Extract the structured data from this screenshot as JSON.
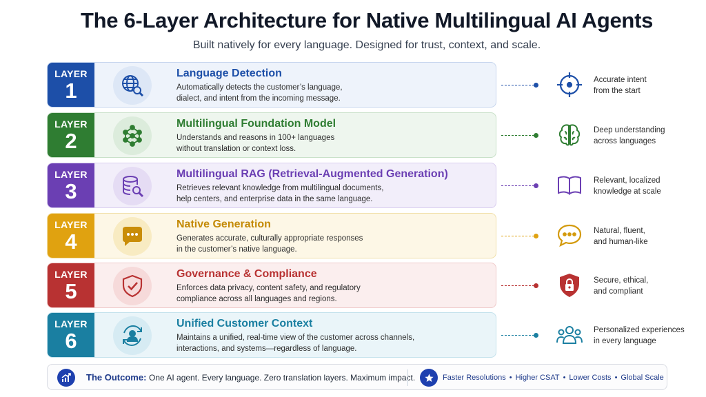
{
  "title": "The 6-Layer Architecture for Native Multilingual AI Agents",
  "subtitle": "Built natively for every language. Designed for trust, context, and scale.",
  "colors": {
    "blue": "#1d4fa8",
    "green": "#2f7d32",
    "purple": "#6b3fb3",
    "gold": "#e0a210",
    "red": "#b83232",
    "teal": "#1a7fa1",
    "navy": "#1e40af"
  },
  "layers": [
    {
      "badge_word": "LAYER",
      "number": "1",
      "title": "Language Detection",
      "desc_line1": "Automatically detects the customer’s language,",
      "desc_line2": "dialect, and intent from the incoming message.",
      "icon": "globe-search-icon",
      "benefit_line1": "Accurate intent",
      "benefit_line2": "from the start",
      "benefit_icon": "crosshair-icon"
    },
    {
      "badge_word": "LAYER",
      "number": "2",
      "title": "Multilingual Foundation Model",
      "desc_line1": "Understands and reasons in 100+ languages",
      "desc_line2": "without translation or context loss.",
      "icon": "neural-network-icon",
      "benefit_line1": "Deep understanding",
      "benefit_line2": "across languages",
      "benefit_icon": "brain-icon"
    },
    {
      "badge_word": "LAYER",
      "number": "3",
      "title": "Multilingual RAG (Retrieval-Augmented Generation)",
      "desc_line1": "Retrieves relevant knowledge from multilingual documents,",
      "desc_line2": "help centers, and enterprise data in the same language.",
      "icon": "database-search-icon",
      "benefit_line1": "Relevant, localized",
      "benefit_line2": "knowledge at scale",
      "benefit_icon": "open-book-icon"
    },
    {
      "badge_word": "LAYER",
      "number": "4",
      "title": "Native Generation",
      "desc_line1": "Generates accurate, culturally appropriate responses",
      "desc_line2": "in the customer’s native language.",
      "icon": "chat-bubble-icon",
      "benefit_line1": "Natural, fluent,",
      "benefit_line2": "and human-like",
      "benefit_icon": "chat-outline-icon"
    },
    {
      "badge_word": "LAYER",
      "number": "5",
      "title": "Governance & Compliance",
      "desc_line1": "Enforces data privacy, content safety, and regulatory",
      "desc_line2": "compliance across all languages and regions.",
      "icon": "shield-check-icon",
      "benefit_line1": "Secure, ethical,",
      "benefit_line2": "and compliant",
      "benefit_icon": "lock-shield-icon"
    },
    {
      "badge_word": "LAYER",
      "number": "6",
      "title": "Unified Customer Context",
      "desc_line1": "Maintains a unified, real-time view of the customer across channels,",
      "desc_line2": "interactions, and systems—regardless of language.",
      "icon": "user-sync-icon",
      "benefit_line1": "Personalized experiences",
      "benefit_line2": "in every language",
      "benefit_icon": "people-group-icon"
    }
  ],
  "outcome": {
    "label": "The Outcome:",
    "text": "One AI agent. Every language. Zero translation layers. Maximum impact.",
    "icon": "growth-chart-icon",
    "metrics_icon": "star-icon",
    "metrics": [
      "Faster Resolutions",
      "Higher CSAT",
      "Lower Costs",
      "Global Scale"
    ],
    "separator": "•"
  }
}
